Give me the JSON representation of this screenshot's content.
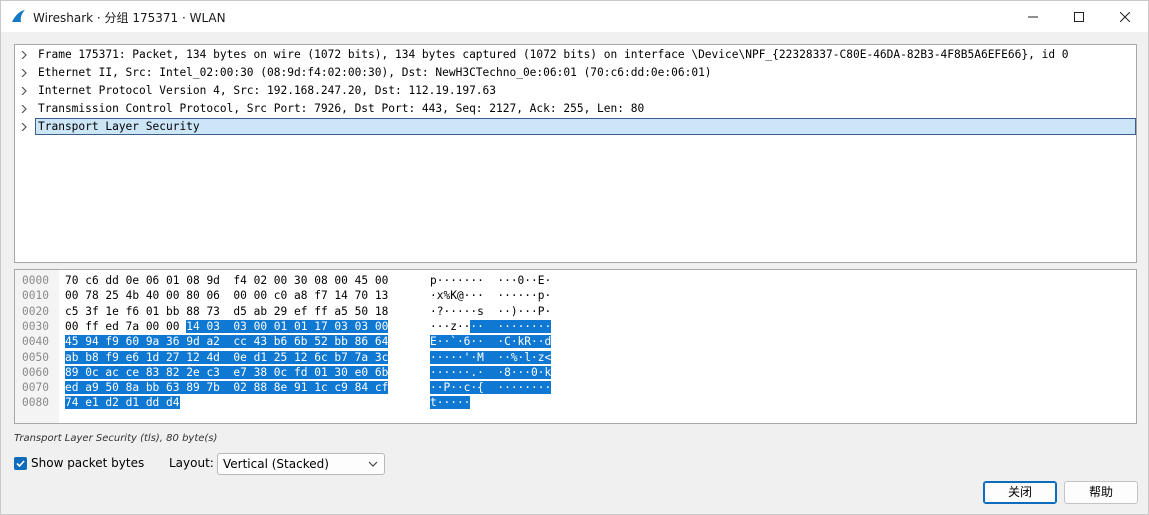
{
  "window": {
    "title": "Wireshark · 分组 175371 · WLAN"
  },
  "tree": {
    "items": [
      {
        "label": "Frame 175371: Packet, 134 bytes on wire (1072 bits), 134 bytes captured (1072 bits) on interface \\Device\\NPF_{22328337-C80E-46DA-82B3-4F8B5A6EFE66}, id 0"
      },
      {
        "label": "Ethernet II, Src: Intel_02:00:30 (08:9d:f4:02:00:30), Dst: NewH3CTechno_0e:06:01 (70:c6:dd:0e:06:01)"
      },
      {
        "label": "Internet Protocol Version 4, Src: 192.168.247.20, Dst: 112.19.197.63"
      },
      {
        "label": "Transmission Control Protocol, Src Port: 7926, Dst Port: 443, Seq: 2127, Ack: 255, Len: 80"
      },
      {
        "label": "Transport Layer Security",
        "selected": true
      }
    ]
  },
  "hex": {
    "rows": [
      {
        "offset": "0000",
        "bytes_plain": "70 c6 dd 0e 06 01 08 9d  f4 02 00 30 08 00 45 00",
        "bytes_hl": "",
        "ascii_plain": "p·······  ···0··E·",
        "ascii_hl": ""
      },
      {
        "offset": "0010",
        "bytes_plain": "00 78 25 4b 40 00 80 06  00 00 c0 a8 f7 14 70 13",
        "bytes_hl": "",
        "ascii_plain": "·x%K@···  ······p·",
        "ascii_hl": ""
      },
      {
        "offset": "0020",
        "bytes_plain": "c5 3f 1e f6 01 bb 88 73  d5 ab 29 ef ff a5 50 18",
        "bytes_hl": "",
        "ascii_plain": "·?·····s  ··)···P·",
        "ascii_hl": ""
      },
      {
        "offset": "0030",
        "bytes_plain": "00 ff ed 7a 00 00 ",
        "bytes_hl": "14 03  03 00 01 01 17 03 03 00",
        "ascii_plain": "···z··",
        "ascii_hl": "··  ········"
      },
      {
        "offset": "0040",
        "bytes_plain": "",
        "bytes_hl": "45 94 f9 60 9a 36 9d a2  cc 43 b6 6b 52 bb 86 64",
        "ascii_plain": "",
        "ascii_hl": "E··`·6··  ·C·kR··d"
      },
      {
        "offset": "0050",
        "bytes_plain": "",
        "bytes_hl": "ab b8 f9 e6 1d 27 12 4d  0e d1 25 12 6c b7 7a 3c",
        "ascii_plain": "",
        "ascii_hl": "·····'·M  ··%·l·z<"
      },
      {
        "offset": "0060",
        "bytes_plain": "",
        "bytes_hl": "89 0c ac ce 83 82 2e c3  e7 38 0c fd 01 30 e0 6b",
        "ascii_plain": "",
        "ascii_hl": "······.·  ·8···0·k"
      },
      {
        "offset": "0070",
        "bytes_plain": "",
        "bytes_hl": "ed a9 50 8a bb 63 89 7b  02 88 8e 91 1c c9 84 cf",
        "ascii_plain": "",
        "ascii_hl": "··P··c·{  ········"
      },
      {
        "offset": "0080",
        "bytes_plain": "",
        "bytes_hl": "74 e1 d2 d1 dd d4",
        "ascii_plain": "",
        "ascii_hl": "t·····"
      }
    ]
  },
  "status": {
    "text": "Transport Layer Security (tls), 80 byte(s)"
  },
  "options": {
    "show_bytes_label": "Show packet bytes",
    "show_bytes_checked": true,
    "layout_label": "Layout:",
    "layout_value": "Vertical (Stacked)"
  },
  "buttons": {
    "close_label": "关闭",
    "help_label": "帮助"
  },
  "colors": {
    "selection_highlight": "#0f78d2",
    "tree_selection_bg": "#cce5f7",
    "accent": "#0f6cbd"
  }
}
